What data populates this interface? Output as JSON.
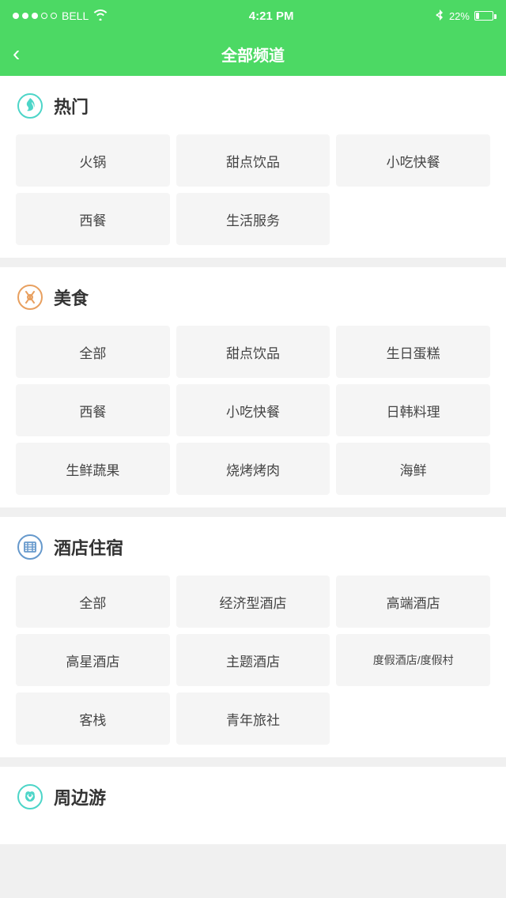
{
  "statusBar": {
    "carrier": "BELL",
    "time": "4:21 PM",
    "battery": "22%",
    "batteryFill": "22"
  },
  "navBar": {
    "title": "全部频道",
    "backLabel": "‹"
  },
  "sections": [
    {
      "id": "hot",
      "title": "热门",
      "iconType": "flame",
      "items": [
        [
          "火锅",
          "甜点饮品",
          "小吃快餐"
        ],
        [
          "西餐",
          "生活服务"
        ]
      ]
    },
    {
      "id": "food",
      "title": "美食",
      "iconType": "fork-x",
      "items": [
        [
          "全部",
          "甜点饮品",
          "生日蛋糕"
        ],
        [
          "西餐",
          "小吃快餐",
          "日韩料理"
        ],
        [
          "生鲜蔬果",
          "烧烤烤肉",
          "海鲜"
        ]
      ]
    },
    {
      "id": "hotel",
      "title": "酒店住宿",
      "iconType": "hotel",
      "items": [
        [
          "全部",
          "经济型酒店",
          "高端酒店"
        ],
        [
          "高星酒店",
          "主题酒店",
          "度假酒店/度假村"
        ],
        [
          "客栈",
          "青年旅社"
        ]
      ]
    },
    {
      "id": "nearby",
      "title": "周边游",
      "iconType": "nearby",
      "items": []
    }
  ]
}
